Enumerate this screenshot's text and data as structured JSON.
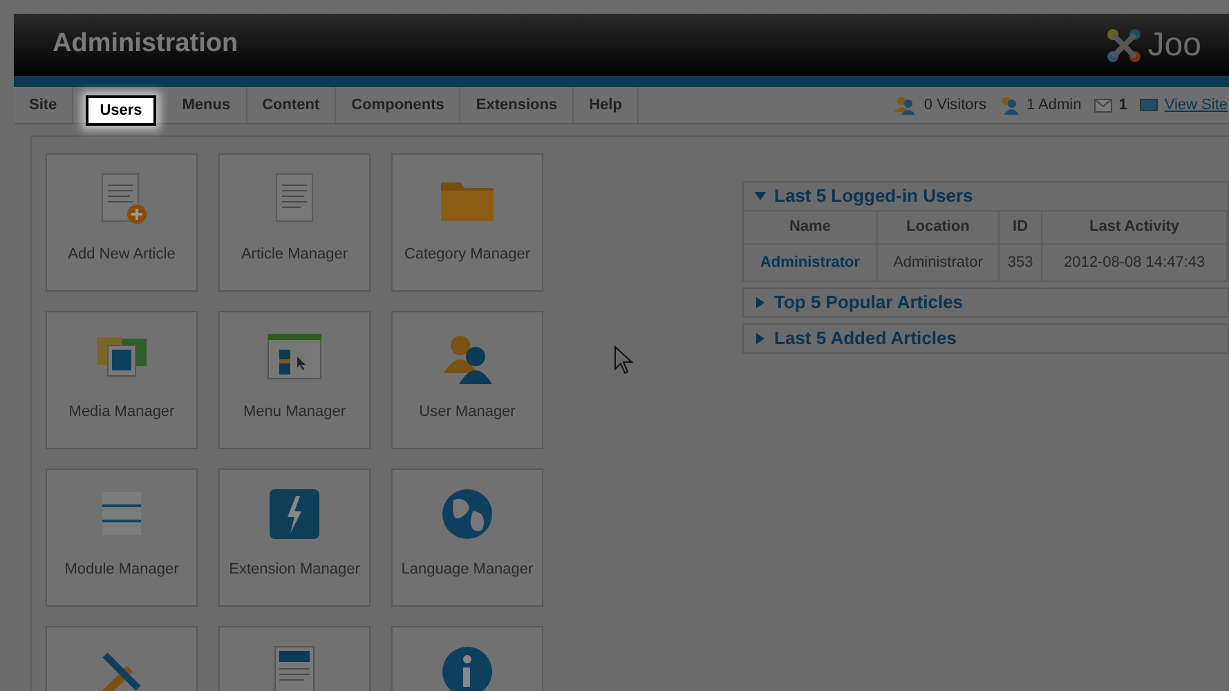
{
  "header": {
    "title": "Administration",
    "logo_text": "Joo"
  },
  "menu": [
    {
      "label": "Site",
      "highlighted": false
    },
    {
      "label": "Users",
      "highlighted": true
    },
    {
      "label": "Menus",
      "highlighted": false
    },
    {
      "label": "Content",
      "highlighted": false
    },
    {
      "label": "Components",
      "highlighted": false
    },
    {
      "label": "Extensions",
      "highlighted": false
    },
    {
      "label": "Help",
      "highlighted": false
    }
  ],
  "status": [
    {
      "kind": "visitors",
      "text": "0 Visitors"
    },
    {
      "kind": "admins",
      "text": "1 Admin"
    },
    {
      "kind": "messages",
      "text": "1"
    },
    {
      "kind": "site",
      "text": "View Site"
    }
  ],
  "tiles": [
    {
      "kind": "add-article",
      "label": "Add New Article"
    },
    {
      "kind": "article",
      "label": "Article Manager"
    },
    {
      "kind": "folder",
      "label": "Category Manager"
    },
    {
      "kind": "media",
      "label": "Media Manager"
    },
    {
      "kind": "menu",
      "label": "Menu Manager"
    },
    {
      "kind": "users",
      "label": "User Manager"
    },
    {
      "kind": "modules",
      "label": "Module Manager"
    },
    {
      "kind": "extension",
      "label": "Extension Manager"
    },
    {
      "kind": "globe",
      "label": "Language Manager"
    },
    {
      "kind": "tools"
    },
    {
      "kind": "template"
    },
    {
      "kind": "info"
    }
  ],
  "panels": [
    {
      "title": "Last 5 Logged-in Users",
      "expanded": true,
      "table": {
        "columns": [
          "Name",
          "Location",
          "ID",
          "Last Activity"
        ],
        "rows": [
          [
            "Administrator",
            "Administrator",
            "353",
            "2012-08-08 14:47:43"
          ]
        ]
      }
    },
    {
      "title": "Top 5 Popular Articles",
      "expanded": false
    },
    {
      "title": "Last 5 Added Articles",
      "expanded": false
    }
  ]
}
